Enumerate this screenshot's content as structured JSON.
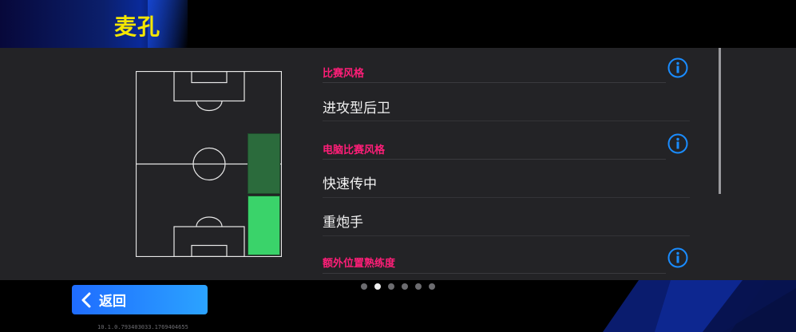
{
  "header": {
    "player_name": "麦孔"
  },
  "pitch": {
    "zones": [
      {
        "name": "zone-rb-upper",
        "level": "secondary",
        "color": "#2b6b3c"
      },
      {
        "name": "zone-rb-lower",
        "level": "primary",
        "color": "#3ad36a"
      }
    ]
  },
  "sections": {
    "playing_style": {
      "title": "比赛风格",
      "value": "进攻型后卫"
    },
    "ai_playing_style": {
      "title": "电脑比赛风格",
      "values": [
        "快速传中",
        "重炮手"
      ]
    },
    "additional_positions": {
      "title": "额外位置熟练度"
    }
  },
  "footer": {
    "back_label": "返回",
    "pager": {
      "total": 6,
      "active_index": 1
    },
    "build": "10.1.0.793403033.1769404655"
  },
  "colors": {
    "name_yellow": "#f4e600",
    "section_pink": "#ff1e78",
    "info_blue": "#1a8cff",
    "button_blue": "#1f6cff"
  }
}
